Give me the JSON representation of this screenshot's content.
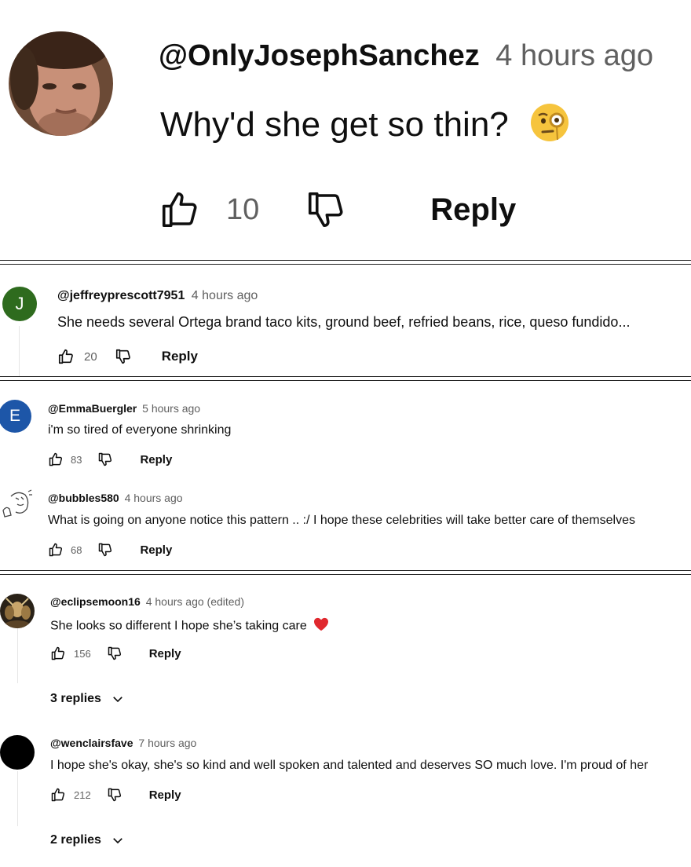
{
  "comments": [
    {
      "handle": "@OnlyJosephSanchez",
      "time": "4 hours ago",
      "text": "Why'd she get so thin?",
      "emoji": "face-with-monocle-icon",
      "likes": "10",
      "reply_label": "Reply"
    },
    {
      "avatar_letter": "J",
      "avatar_color": "#2e6b1e",
      "handle": "@jeffreyprescott7951",
      "time": "4 hours ago",
      "text": "She needs several Ortega brand taco kits, ground beef, refried beans, rice, queso fundido...",
      "likes": "20",
      "reply_label": "Reply"
    },
    {
      "avatar_letter": "E",
      "avatar_color": "#1d56a8",
      "handle": "@EmmaBuergler",
      "time": "5 hours ago",
      "text": "i'm so tired of everyone shrinking",
      "likes": "83",
      "reply_label": "Reply"
    },
    {
      "handle": "@bubbles580",
      "time": "4 hours ago",
      "text": "What is going on anyone notice this pattern .. :/ I hope these celebrities will take better care of themselves",
      "likes": "68",
      "reply_label": "Reply"
    },
    {
      "handle": "@eclipsemoon16",
      "time": "4 hours ago (edited)",
      "text": "She looks so different I hope she’s taking care",
      "emoji": "red-heart-icon",
      "likes": "156",
      "reply_label": "Reply",
      "replies_label": "3 replies"
    },
    {
      "handle": "@wenclairsfave",
      "time": "7 hours ago",
      "text": "I hope she's okay, she's so kind and well spoken and talented and deserves SO much love. I'm proud of her",
      "likes": "212",
      "reply_label": "Reply",
      "replies_label": "2 replies"
    }
  ],
  "colors": {
    "text": "#0f0f0f",
    "secondary": "#606060",
    "heart": "#e0282e"
  }
}
